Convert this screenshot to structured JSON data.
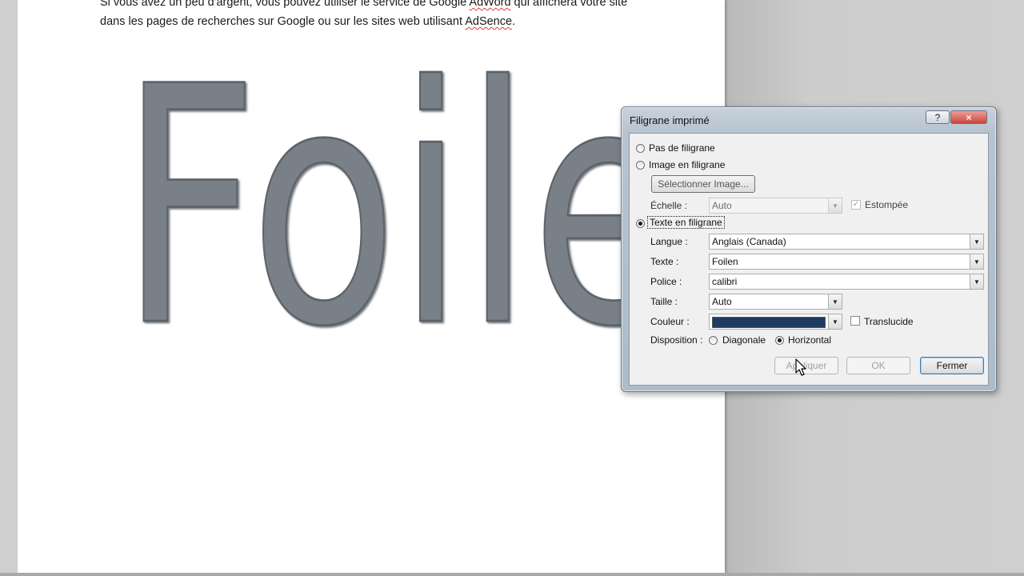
{
  "document": {
    "line1_parts": [
      "Si vous avez un peu d'argent, vous pouvez utiliser le service de Google ",
      "AdWord",
      " qui affichera votre site"
    ],
    "line2_parts": [
      "dans les pages de recherches sur Google ou sur les sites web utilisant ",
      "AdSence",
      "."
    ],
    "watermark_text": "Foilen"
  },
  "dialog": {
    "title": "Filigrane imprimé",
    "help_label": "?",
    "close_label": "×",
    "no_watermark_label": "Pas de filigrane",
    "picture_watermark_label": "Image en filigrane",
    "select_picture_label": "Sélectionner Image...",
    "scale_label": "Échelle :",
    "scale_value": "Auto",
    "washout_label": "Estompée",
    "text_watermark_label": "Texte en filigrane",
    "language_label": "Langue :",
    "language_value": "Anglais (Canada)",
    "text_label": "Texte :",
    "text_value": "Foilen",
    "font_label": "Police :",
    "font_value": "calibri",
    "size_label": "Taille :",
    "size_value": "Auto",
    "color_label": "Couleur :",
    "color_value": "#1f3a5f",
    "semitransparent_label": "Translucide",
    "layout_label": "Disposition :",
    "diagonal_label": "Diagonale",
    "horizontal_label": "Horizontal",
    "apply_label": "Appliquer",
    "ok_label": "OK",
    "close_button_label": "Fermer",
    "selected_option": "Texte en filigrane",
    "selected_layout": "Horizontal"
  },
  "icons": {
    "combo_arrow": "chevron-down-icon",
    "cursor": "mouse-pointer-icon"
  }
}
